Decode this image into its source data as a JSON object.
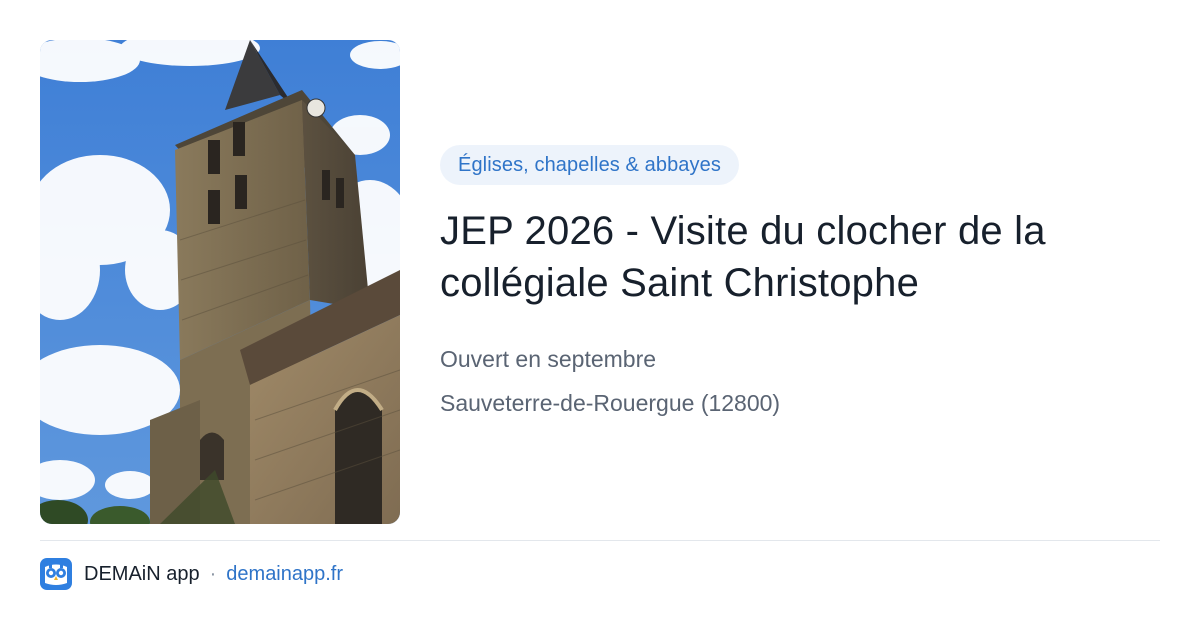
{
  "category": "Églises, chapelles & abbayes",
  "title_line1": "JEP 2026 - Visite du clocher de la",
  "title_line2": "collégiale Saint Christophe",
  "schedule": "Ouvert en septembre",
  "location": "Sauveterre-de-Rouergue (12800)",
  "footer": {
    "app_name": "DEMAiN app",
    "separator": "·",
    "domain": "demainapp.fr",
    "app_icon": "owl-app-icon"
  },
  "photo": {
    "subject": "church-bell-tower-photo"
  },
  "colors": {
    "accent": "#2f74c8",
    "badge_bg": "#edf3fb",
    "title": "#17202c",
    "meta": "#5a6473",
    "divider": "#e3e7ec"
  }
}
